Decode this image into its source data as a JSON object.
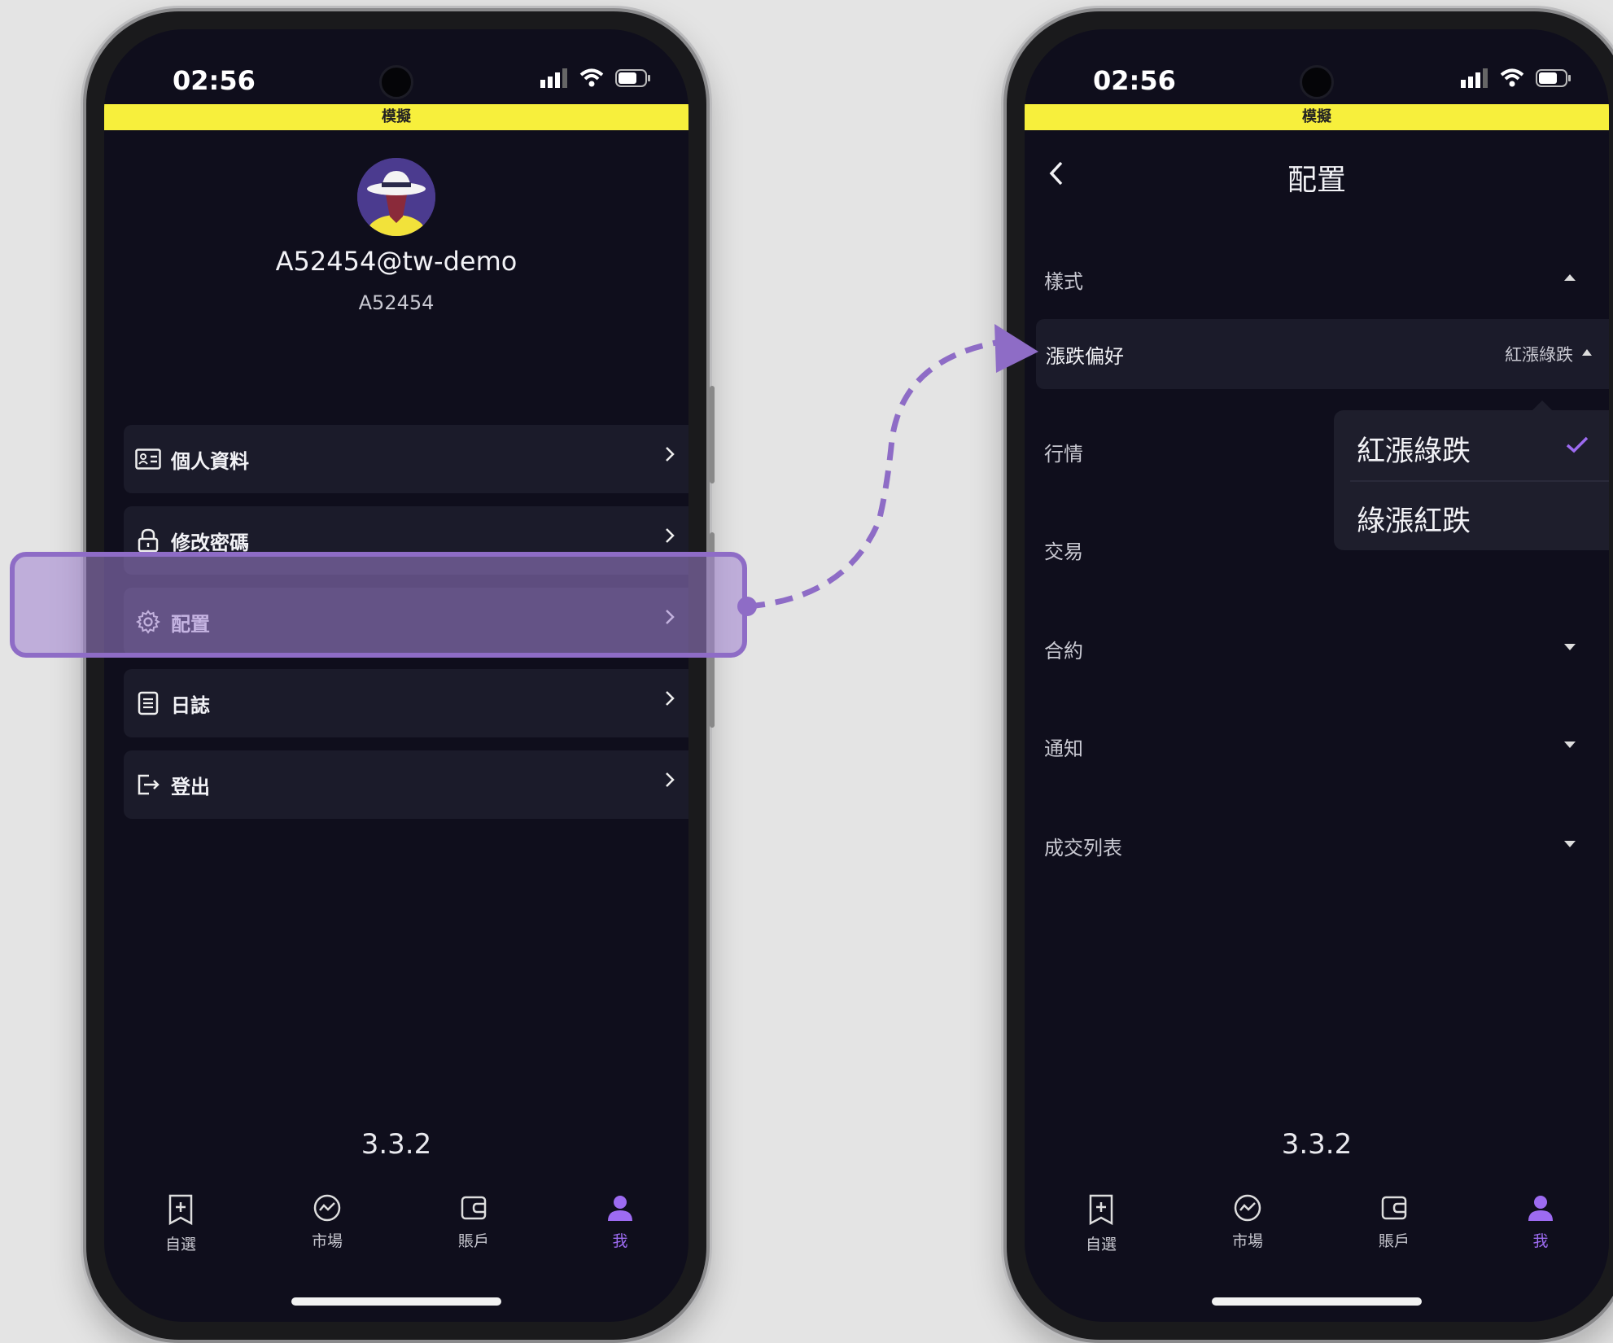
{
  "left_screen": {
    "status": {
      "time": "02:56"
    },
    "demo_banner": "模擬",
    "profile": {
      "username": "A52454@tw-demo",
      "user_id": "A52454"
    },
    "menu": [
      {
        "label": "個人資料",
        "icon": "id-card-icon"
      },
      {
        "label": "修改密碼",
        "icon": "lock-icon"
      },
      {
        "label": "配置",
        "icon": "gear-icon"
      },
      {
        "label": "日誌",
        "icon": "document-icon"
      },
      {
        "label": "登出",
        "icon": "logout-icon"
      }
    ],
    "version": "3.3.2",
    "tabs": [
      {
        "label": "自選",
        "icon": "bookmark-plus-icon",
        "active": false
      },
      {
        "label": "市場",
        "icon": "market-chart-icon",
        "active": false
      },
      {
        "label": "賬戶",
        "icon": "wallet-icon",
        "active": false
      },
      {
        "label": "我",
        "icon": "person-icon",
        "active": true
      }
    ]
  },
  "right_screen": {
    "status": {
      "time": "02:56"
    },
    "demo_banner": "模擬",
    "nav_title": "配置",
    "sections": [
      {
        "label": "樣式",
        "expanded": true
      },
      {
        "label": "行情",
        "expanded": false
      },
      {
        "label": "交易",
        "expanded": false
      },
      {
        "label": "合約",
        "expanded": false
      },
      {
        "label": "通知",
        "expanded": false
      },
      {
        "label": "成交列表",
        "expanded": false
      }
    ],
    "preference_row": {
      "label": "漲跌偏好",
      "value": "紅漲綠跌"
    },
    "dropdown_options": [
      {
        "label": "紅漲綠跌",
        "selected": true
      },
      {
        "label": "綠漲紅跌",
        "selected": false
      }
    ],
    "version": "3.3.2",
    "tabs": [
      {
        "label": "自選",
        "icon": "bookmark-plus-icon",
        "active": false
      },
      {
        "label": "市場",
        "icon": "market-chart-icon",
        "active": false
      },
      {
        "label": "賬戶",
        "icon": "wallet-icon",
        "active": false
      },
      {
        "label": "我",
        "icon": "person-icon",
        "active": true
      }
    ]
  },
  "colors": {
    "accent": "#9d6bf1",
    "demo_banner": "#f7ef3c",
    "screen_bg": "#0f0e1c",
    "row_bg": "#1b1b2a",
    "highlight": "#8e6cc6"
  }
}
